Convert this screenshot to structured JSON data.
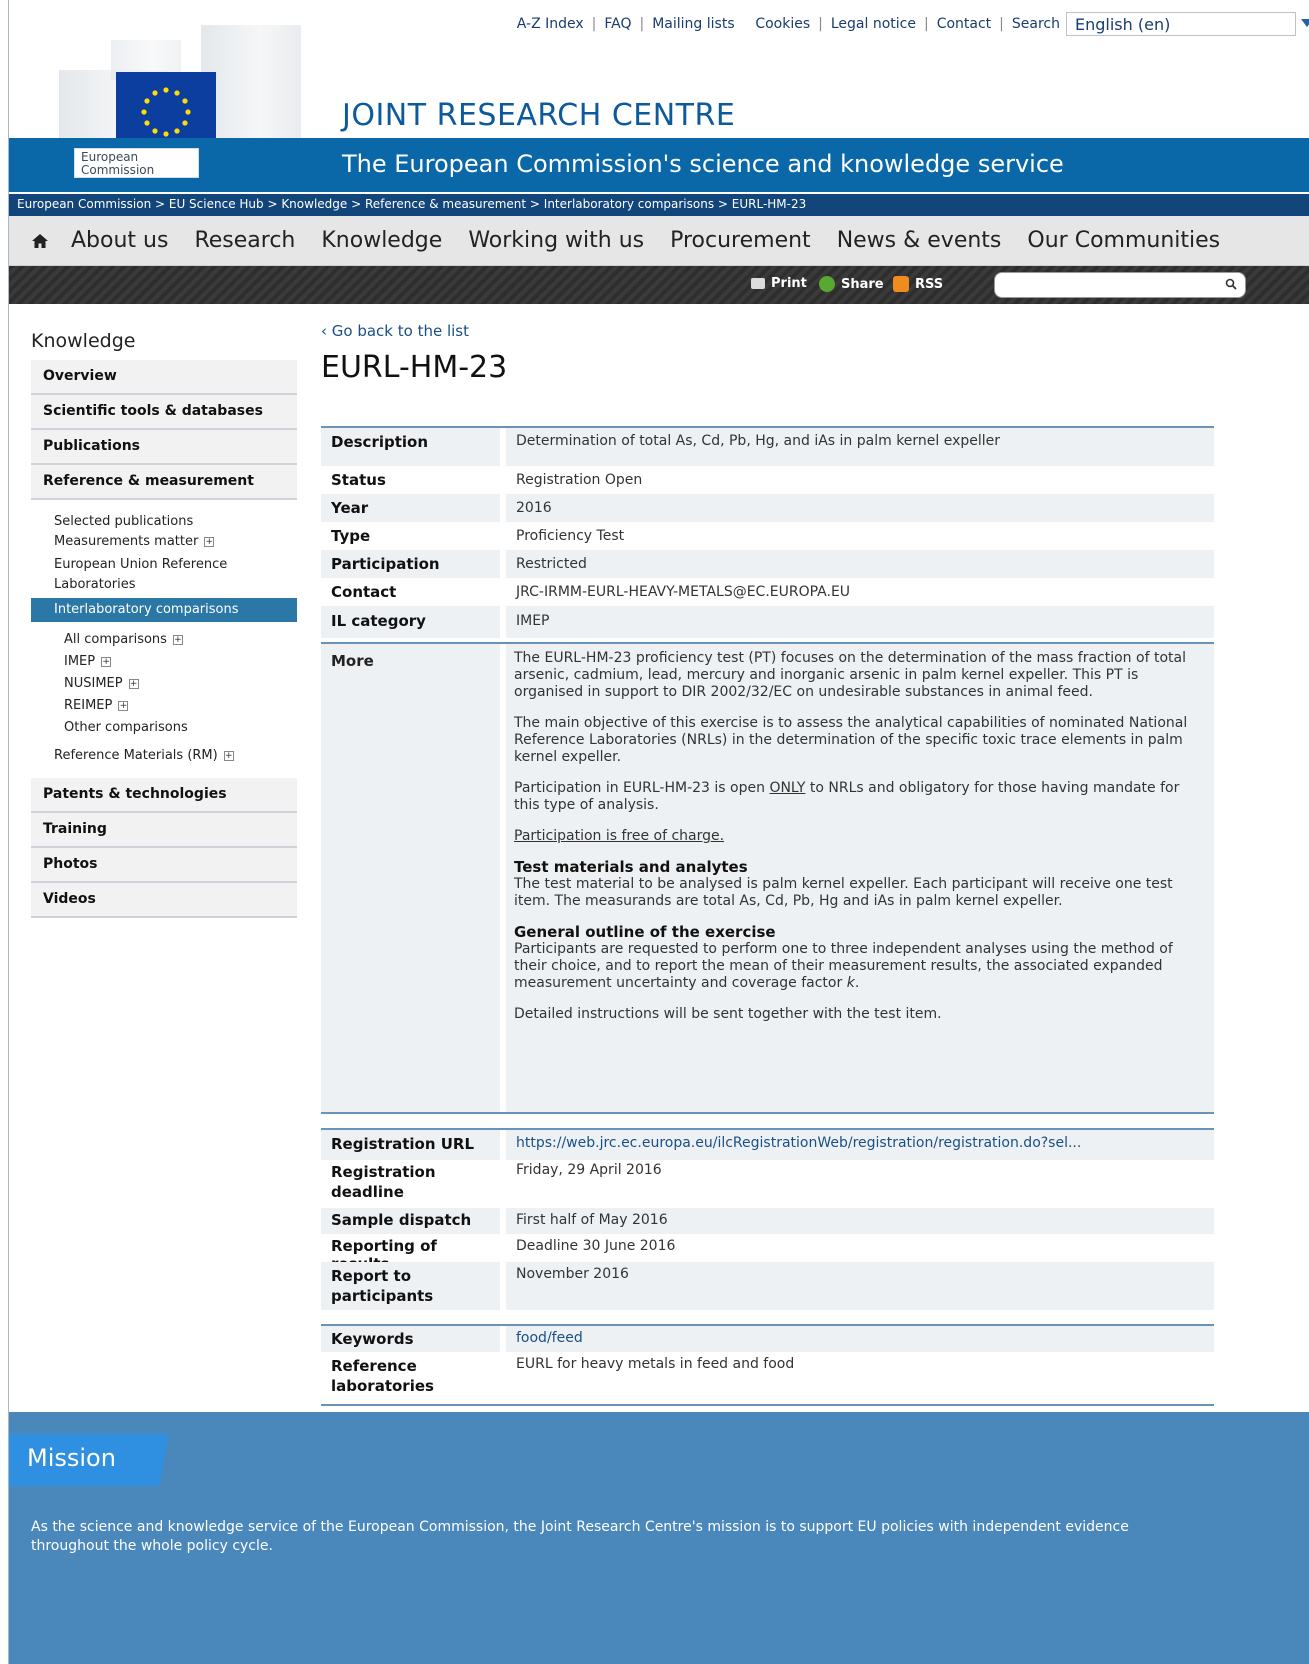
{
  "toplinks": {
    "items": [
      "A-Z Index",
      "FAQ",
      "Mailing lists",
      "Cookies",
      "Legal notice",
      "Contact",
      "Search"
    ],
    "language": "English (en)"
  },
  "header": {
    "ec_label_1": "European",
    "ec_label_2": "Commission",
    "site_title": "JOINT RESEARCH CENTRE",
    "tagline": "The European Commission's science and knowledge service"
  },
  "breadcrumb": "European Commission > EU Science Hub > Knowledge > Reference & measurement > Interlaboratory comparisons > EURL-HM-23",
  "nav": [
    "About us",
    "Research",
    "Knowledge",
    "Working with us",
    "Procurement",
    "News & events",
    "Our Communities"
  ],
  "toolbar": {
    "print": "Print",
    "share": "Share",
    "rss": "RSS"
  },
  "sidebar": {
    "title": "Knowledge",
    "top_items": [
      "Overview",
      "Scientific tools & databases",
      "Publications",
      "Reference & measurement"
    ],
    "sub_items": [
      "Selected publications",
      "Measurements matter",
      "European Union Reference",
      "Laboratories",
      "Interlaboratory comparisons"
    ],
    "sub2_items": [
      "All comparisons",
      "IMEP",
      "NUSIMEP",
      "REIMEP",
      "Other comparisons"
    ],
    "rm_item": "Reference Materials (RM)",
    "bottom_items": [
      "Patents & technologies",
      "Training",
      "Photos",
      "Videos"
    ]
  },
  "main": {
    "back_link": "‹ Go back to the list",
    "title": "EURL-HM-23",
    "fields": {
      "description_k": "Description",
      "description_v": "Determination of total As, Cd, Pb, Hg, and iAs in palm kernel expeller",
      "status_k": "Status",
      "status_v": "Registration Open",
      "year_k": "Year",
      "year_v": "2016",
      "type_k": "Type",
      "type_v": "Proficiency Test",
      "participation_k": "Participation",
      "participation_v": "Restricted",
      "contact_k": "Contact",
      "contact_v": "JRC-IRMM-EURL-HEAVY-METALS@EC.EUROPA.EU",
      "ilcat_k": "IL category",
      "ilcat_v": "IMEP"
    },
    "more": {
      "label": "More",
      "p1": "The EURL-HM-23 proficiency test (PT) focuses on the determination of the mass fraction of total arsenic, cadmium, lead, mercury and inorganic arsenic in palm kernel expeller. This PT is organised in support to DIR 2002/32/EC on undesirable substances in animal feed.",
      "p2": "The main objective of this exercise is to assess the analytical capabilities of nominated National Reference Laboratories (NRLs) in the determination of the specific toxic trace elements in palm kernel expeller.",
      "p3_a": "Participation in EURL-HM-23 is open ",
      "p3_u": "ONLY",
      "p3_b": " to NRLs and obligatory for those having mandate for this type of analysis.",
      "p4": "Participation is free of charge.",
      "h1": "Test materials and analytes",
      "p5": "The test material to be analysed is palm kernel expeller. Each participant will receive one test item. The measurands are total As, Cd, Pb, Hg and iAs in palm kernel expeller.",
      "h2": "General outline of the exercise",
      "p6_a": "Participants are requested to perform one to three independent analyses using the method of their choice, and to report the mean of their measurement results, the associated expanded measurement uncertainty and coverage factor ",
      "p6_k": "k",
      "p6_b": ".",
      "p7": "Detailed instructions will be sent together with the test item."
    },
    "reg": {
      "url_k": "Registration URL",
      "url_v": "https://web.jrc.ec.europa.eu/ilcRegistrationWeb/registration/registration.do?sel...",
      "deadline_k1": "Registration",
      "deadline_k2": "deadline",
      "deadline_v": "Friday, 29 April 2016",
      "dispatch_k": "Sample dispatch",
      "dispatch_v": "First half of May 2016",
      "reporting_k": "Reporting of results",
      "reporting_v": "Deadline 30 June 2016",
      "report_k1": "Report to",
      "report_k2": "participants",
      "report_v": "November 2016"
    },
    "kw": {
      "keywords_k": "Keywords",
      "keywords_v": "food/feed",
      "reflab_k1": "Reference",
      "reflab_k2": "laboratories",
      "reflab_v": "EURL for heavy metals in feed and food"
    }
  },
  "footer": {
    "mission_title": "Mission",
    "mission_text": "As the science and knowledge service of the European Commission, the Joint Research Centre's mission is to support EU policies with independent evidence throughout the whole policy cycle."
  },
  "colors": {
    "brand_blue": "#0a68a8",
    "breadcrumb": "#12457a",
    "footer": "#4a87ba",
    "active_side": "#2b78a6"
  }
}
